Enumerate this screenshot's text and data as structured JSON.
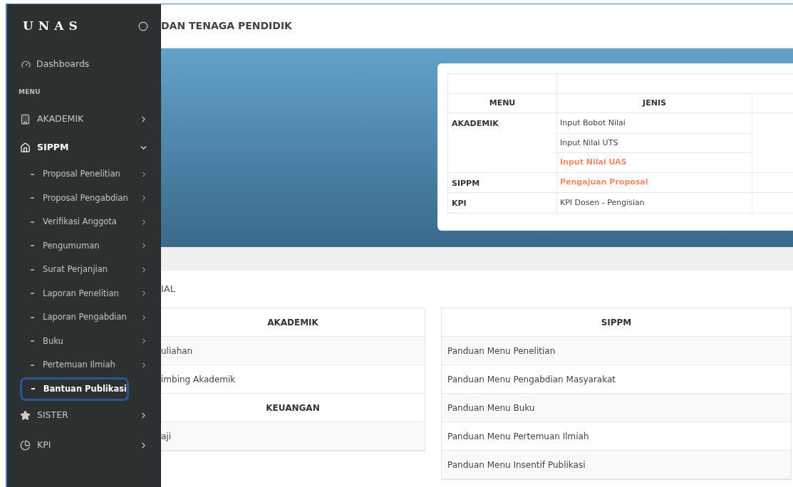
{
  "sidebar": {
    "logo": "UNAS",
    "items": [
      {
        "label": "Dashboards"
      }
    ],
    "section_label": "MENU",
    "menu": [
      {
        "label": "AKADEMIK",
        "expanded": false
      },
      {
        "label": "SIPPM",
        "expanded": true,
        "children": [
          {
            "label": "Proposal Penelitian",
            "selected": false,
            "has_submenu": true
          },
          {
            "label": "Proposal Pengabdian",
            "selected": false,
            "has_submenu": true
          },
          {
            "label": "Verifikasi Anggota",
            "selected": false,
            "has_submenu": true
          },
          {
            "label": "Pengumuman",
            "selected": false,
            "has_submenu": true
          },
          {
            "label": "Surat Perjanjian",
            "selected": false,
            "has_submenu": true
          },
          {
            "label": "Laporan Penelitian",
            "selected": false,
            "has_submenu": true
          },
          {
            "label": "Laporan Pengabdian",
            "selected": false,
            "has_submenu": true
          },
          {
            "label": "Buku",
            "selected": false,
            "has_submenu": true
          },
          {
            "label": "Pertemuan Ilmiah",
            "selected": false,
            "has_submenu": true
          },
          {
            "label": "Bantuan Publikasi",
            "selected": true,
            "has_submenu": false
          }
        ]
      },
      {
        "label": "SISTER",
        "expanded": false
      },
      {
        "label": "KPI",
        "expanded": false
      }
    ]
  },
  "header": {
    "title": "DAN TENAGA PENDIDIK"
  },
  "banner_table": {
    "columns": [
      "MENU",
      "JENIS"
    ],
    "rows": [
      {
        "menu": "AKADEMIK",
        "items": [
          {
            "text": "Input Bobot Nilai",
            "highlighted": false
          },
          {
            "text": "Input Nilai UTS",
            "highlighted": false
          },
          {
            "text": "Input Nilai UAS",
            "highlighted": true
          }
        ]
      },
      {
        "menu": "SIPPM",
        "items": [
          {
            "text": "Pengajuan Proposal",
            "highlighted": true
          }
        ]
      },
      {
        "menu": "KPI",
        "items": [
          {
            "text": "KPI Dosen - Pengisian",
            "highlighted": false
          }
        ]
      }
    ]
  },
  "section_title": "IAL",
  "left_panel": [
    {
      "heading": "AKADEMIK",
      "rows": [
        "uliahan",
        "imbing Akademik"
      ]
    },
    {
      "heading": "KEUANGAN",
      "rows": [
        "aji"
      ]
    }
  ],
  "right_panel": [
    {
      "heading": "SIPPM",
      "rows": [
        "Panduan Menu Penelitian",
        "Panduan Menu Pengabdian Masyarakat",
        "Panduan Menu Buku",
        "Panduan Menu Pertemuan Ilmiah",
        "Panduan Menu Insentif Publikasi"
      ]
    }
  ]
}
